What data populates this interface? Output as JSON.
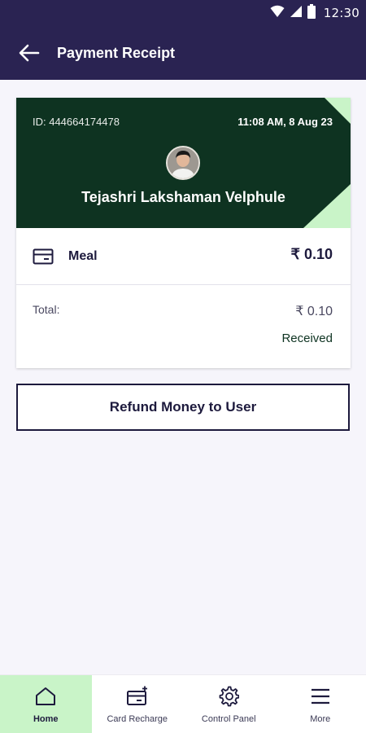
{
  "status_bar": {
    "time": "12:30",
    "icons": [
      "wifi-icon",
      "signal-icon",
      "battery-icon"
    ]
  },
  "app_bar": {
    "title": "Payment Receipt",
    "back_icon": "arrow-left-icon"
  },
  "receipt": {
    "transaction_id": "ID: 444664174478",
    "timestamp": "11:08 AM, 8 Aug 23",
    "user_name": "Tejashri Lakshaman Velphule",
    "item": {
      "icon": "card-icon",
      "label": "Meal",
      "amount": "₹ 0.10"
    },
    "total_label": "Total:",
    "total_amount": "₹ 0.10",
    "status": "Received"
  },
  "actions": {
    "refund_label": "Refund Money to User"
  },
  "bottom_nav": {
    "items": [
      {
        "label": "Home",
        "icon": "home-icon",
        "active": true
      },
      {
        "label": "Card Recharge",
        "icon": "card-recharge-icon",
        "active": false
      },
      {
        "label": "Control Panel",
        "icon": "gear-icon",
        "active": false
      },
      {
        "label": "More",
        "icon": "menu-icon",
        "active": false
      }
    ]
  },
  "colors": {
    "app_bar": "#2a2352",
    "card_header": "#0e3321",
    "accent_green": "#c9f4c8",
    "background": "#f6f5fb",
    "text_dark": "#1d1a3d"
  }
}
